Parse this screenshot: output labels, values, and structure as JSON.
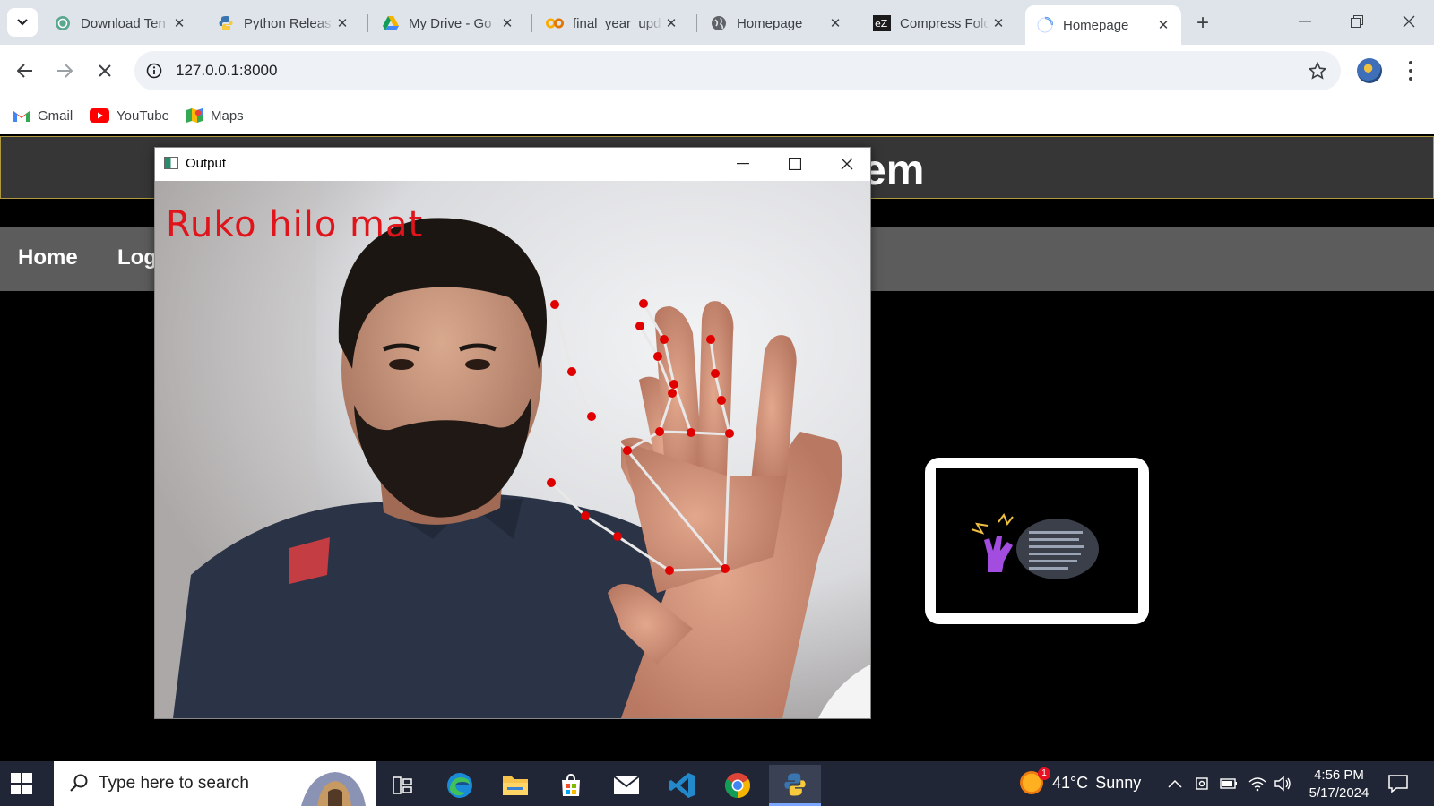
{
  "browser": {
    "tabs": [
      {
        "title": "Download Ten",
        "icon": "chatgpt-icon"
      },
      {
        "title": "Python Releas",
        "icon": "python-icon"
      },
      {
        "title": "My Drive - Go",
        "icon": "google-drive-icon"
      },
      {
        "title": "final_year_upd",
        "icon": "colab-icon"
      },
      {
        "title": "Homepage",
        "icon": "globe-icon"
      },
      {
        "title": "Compress Fold",
        "icon": "ezyzip-icon"
      },
      {
        "title": "Homepage",
        "icon": "loading-spinner-icon",
        "active": true
      }
    ],
    "url": "127.0.0.1:8000",
    "bookmarks": [
      {
        "label": "Gmail",
        "icon": "gmail-icon"
      },
      {
        "label": "YouTube",
        "icon": "youtube-icon"
      },
      {
        "label": "Maps",
        "icon": "maps-icon"
      }
    ]
  },
  "page": {
    "banner_title_visible": "e System",
    "nav": [
      {
        "label": "Home"
      },
      {
        "label": "Log"
      }
    ]
  },
  "output_window": {
    "title": "Output",
    "overlay_text": "Ruko  hilo  mat",
    "overlay_color": "#e0141b",
    "landmark_color": "#e00000",
    "skeleton_color": "#e8e8e8"
  },
  "taskbar": {
    "search_placeholder": "Type here to search",
    "apps": [
      "task-view-icon",
      "edge-icon",
      "file-explorer-icon",
      "store-icon",
      "mail-icon",
      "vscode-icon",
      "chrome-icon",
      "python-icon"
    ],
    "weather": {
      "temp": "41°C",
      "condition": "Sunny",
      "badge": "1"
    },
    "time": "4:56 PM",
    "date": "5/17/2024"
  }
}
